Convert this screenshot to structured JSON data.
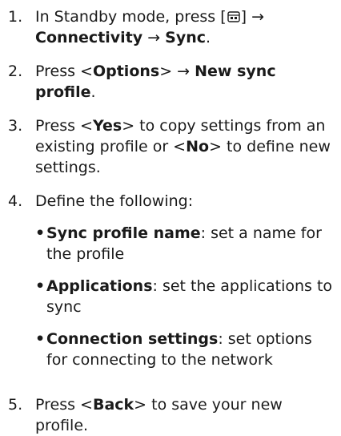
{
  "steps": [
    {
      "number": "1.",
      "s1_text1": "In Standby mode, press [",
      "s1_icon": "menu-key-icon",
      "s1_text2": "] →",
      "s1_b1": "Connectivity",
      "s1_arrow": " → ",
      "s1_b2": "Sync",
      "s1_end": "."
    },
    {
      "number": "2.",
      "s2_text1": "Press <",
      "s2_b1": "Options",
      "s2_text2": "> → ",
      "s2_b2": "New sync profile",
      "s2_end": "."
    },
    {
      "number": "3.",
      "s3_text1": "Press <",
      "s3_b1": "Yes",
      "s3_text2": "> to copy settings from an existing profile or <",
      "s3_b2": "No",
      "s3_text3": "> to define new settings."
    },
    {
      "number": "4.",
      "s4_text": "Define the following:",
      "bullets": [
        {
          "dot": "•",
          "label": "Sync profile name",
          "desc": ": set a name for the profile"
        },
        {
          "dot": "•",
          "label": "Applications",
          "desc": ": set the applications to sync"
        },
        {
          "dot": "•",
          "label": "Connection settings",
          "desc": ": set options for connecting to the network"
        }
      ]
    },
    {
      "number": "5.",
      "s5_text1": "Press <",
      "s5_b1": "Back",
      "s5_text2": "> to save your new profile."
    }
  ]
}
